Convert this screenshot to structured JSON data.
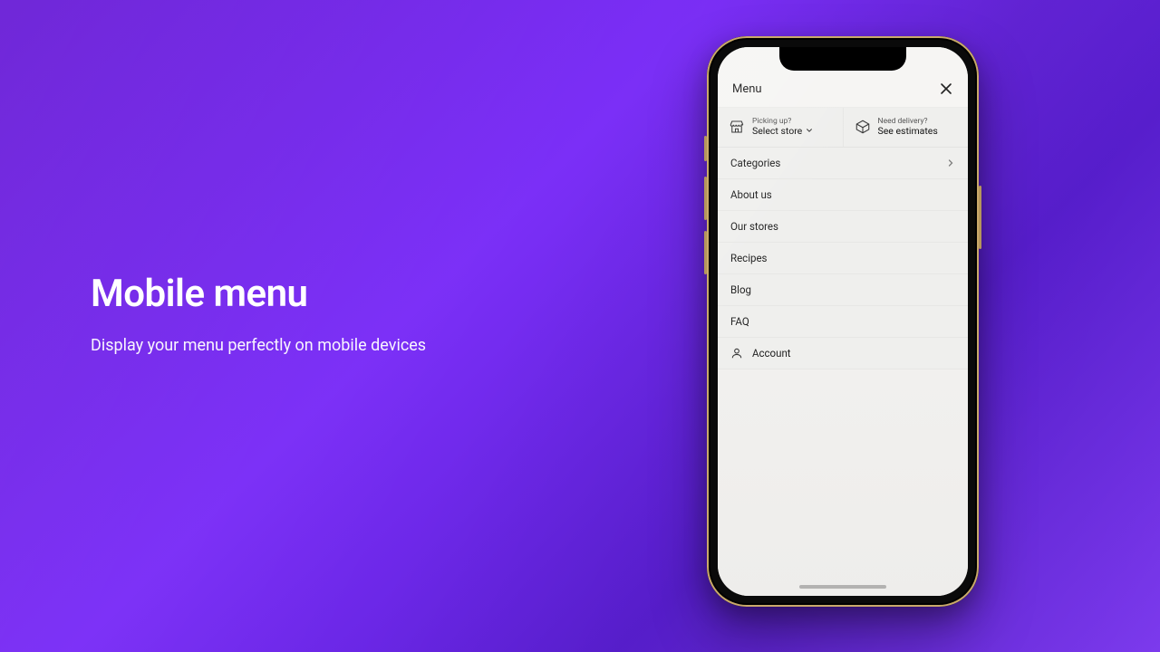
{
  "hero": {
    "title": "Mobile menu",
    "subtitle": "Display your menu perfectly on mobile devices"
  },
  "phone": {
    "header": {
      "title": "Menu"
    },
    "actions": {
      "pickup": {
        "hint": "Picking up?",
        "label": "Select store"
      },
      "delivery": {
        "hint": "Need delivery?",
        "label": "See estimates"
      }
    },
    "menu": {
      "categories": "Categories",
      "about": "About us",
      "stores": "Our stores",
      "recipes": "Recipes",
      "blog": "Blog",
      "faq": "FAQ",
      "account": "Account"
    }
  }
}
